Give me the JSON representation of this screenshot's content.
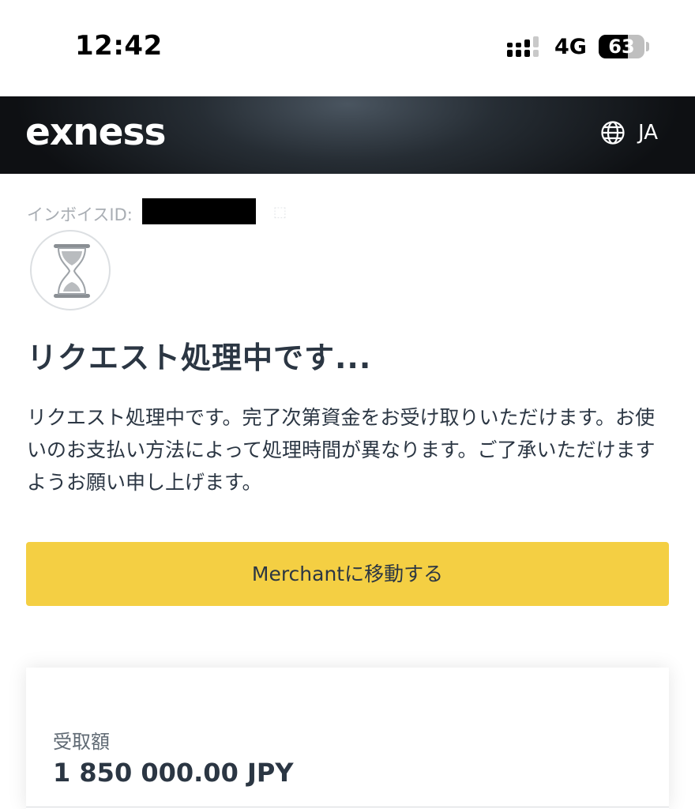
{
  "status_bar": {
    "time": "12:42",
    "network": "4G",
    "battery": "63",
    "battery_level": 0.63
  },
  "header": {
    "logo": "exness",
    "language": "JA",
    "language_icon": "globe-icon"
  },
  "invoice": {
    "label": "インボイスID:"
  },
  "status_icon": "hourglass-icon",
  "title": "リクエスト処理中です...",
  "description": "リクエスト処理中です。完了次第資金をお受け取りいただけます。お使いのお支払い方法によって処理時間が異なります。ご了承いただけますようお願い申し上げます。",
  "merchant_button": {
    "label": "Merchantに移動する"
  },
  "receipt": {
    "label": "受取額",
    "amount": "1 850 000.00 JPY"
  },
  "colors": {
    "accent": "#f4cf43",
    "header_dark": "#0e1013",
    "text_primary": "#2b3643"
  }
}
